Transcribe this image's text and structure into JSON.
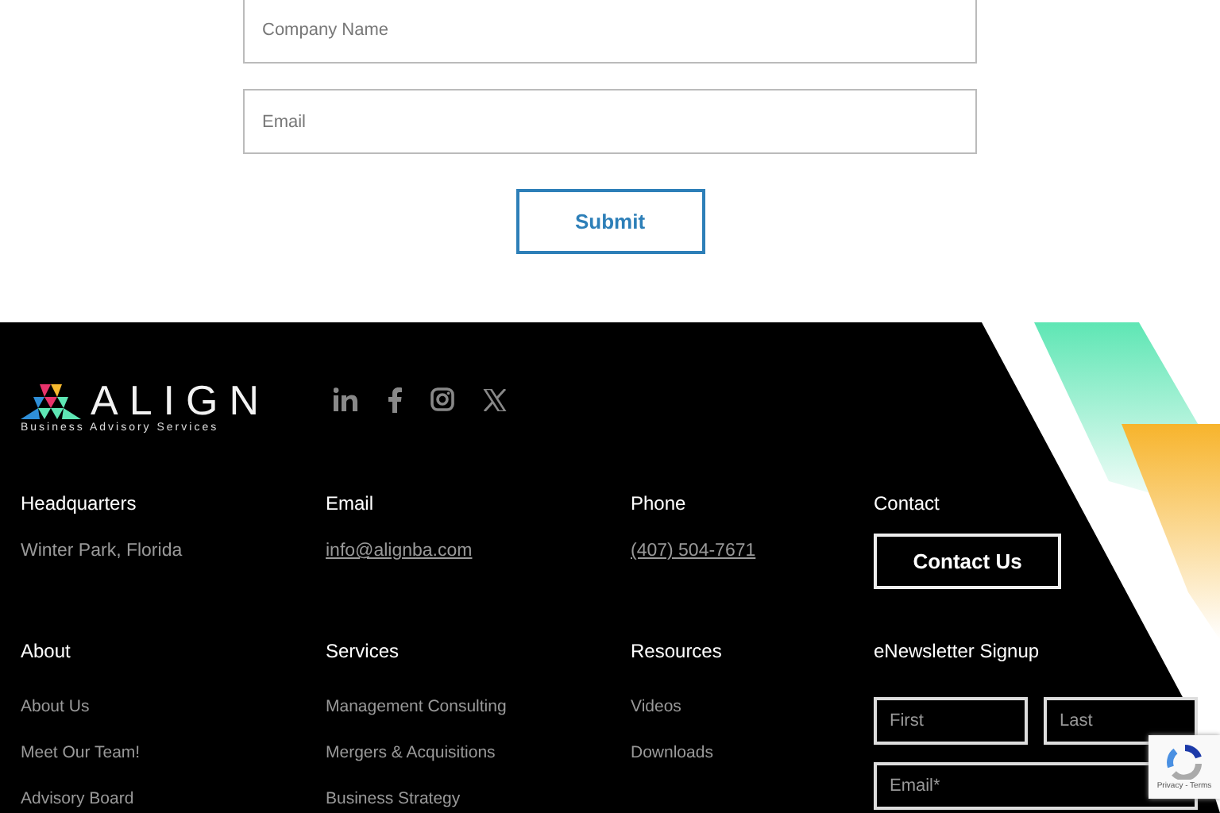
{
  "form": {
    "fields": [
      {
        "placeholder": "Company Name"
      },
      {
        "placeholder": "Email"
      }
    ],
    "submit": "Submit"
  },
  "footer": {
    "logo": {
      "name": "ALIGN",
      "tagline": "Business Advisory Services"
    },
    "top_columns": [
      {
        "heading": "Headquarters",
        "kind": "text",
        "text": "Winter Park, Florida"
      },
      {
        "heading": "Email",
        "kind": "link",
        "text": "info@alignba.com"
      },
      {
        "heading": "Phone",
        "kind": "link",
        "text": "(407) 504-7671"
      },
      {
        "heading": "Contact",
        "kind": "button",
        "text": "Contact Us"
      }
    ],
    "bottom_columns": [
      {
        "heading": "About",
        "kind": "links",
        "links": [
          "About Us",
          "Meet Our Team!",
          "Advisory Board"
        ]
      },
      {
        "heading": "Services",
        "kind": "links",
        "links": [
          "Management Consulting",
          "Mergers & Acquisitions",
          "Business Strategy"
        ]
      },
      {
        "heading": "Resources",
        "kind": "links",
        "links": [
          "Videos",
          "Downloads"
        ]
      },
      {
        "heading": "eNewsletter Signup",
        "kind": "signup",
        "first_placeholder": "First",
        "last_placeholder": "Last",
        "email_placeholder": "Email*"
      }
    ]
  },
  "recaptcha": {
    "text": "Privacy - Terms"
  }
}
